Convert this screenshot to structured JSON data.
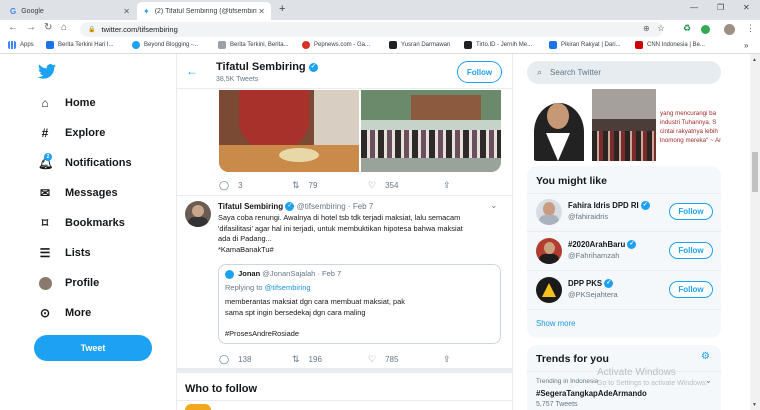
{
  "browser": {
    "tabs": [
      {
        "title": "Google"
      },
      {
        "title": "(2) Tifatul Sembiring (@tifsembiri"
      }
    ],
    "url": "twitter.com/tifsembiring",
    "bookmarks": [
      {
        "label": "Apps",
        "color": "#4285f4"
      },
      {
        "label": "Berita Terkini Hari I...",
        "color": "#1a73e8"
      },
      {
        "label": "Beyond Blogging -...",
        "color": "#1da1f2"
      },
      {
        "label": "Berita Terkini, Berita...",
        "color": "#9aa0a6"
      },
      {
        "label": "Pepnews.com - Ga...",
        "color": "#d93025"
      },
      {
        "label": "Yusran Darmawan",
        "color": "#202124"
      },
      {
        "label": "Tirto.ID - Jernih Me...",
        "color": "#202124"
      },
      {
        "label": "Pikiran Rakyat | Dari...",
        "color": "#1a73e8"
      },
      {
        "label": "CNN Indonesia | Be...",
        "color": "#cc0000"
      }
    ]
  },
  "nav": {
    "items": [
      {
        "label": "Home"
      },
      {
        "label": "Explore"
      },
      {
        "label": "Notifications",
        "badge": "2"
      },
      {
        "label": "Messages"
      },
      {
        "label": "Bookmarks"
      },
      {
        "label": "Lists"
      },
      {
        "label": "Profile"
      },
      {
        "label": "More"
      }
    ],
    "tweet_label": "Tweet"
  },
  "header": {
    "name": "Tifatul Sembiring",
    "tweets_count": "38,5K Tweets",
    "follow_label": "Follow"
  },
  "tweet1": {
    "replies": "3",
    "retweets": "79",
    "likes": "354"
  },
  "tweet2": {
    "name": "Tifatul Sembiring",
    "handle": "@tifsembiring",
    "date": "· Feb 7",
    "text_lines": [
      "Saya coba renungi. Awalnya di hotel tsb tdk terjadi maksiat, lalu semacam",
      "'difasilitasi' agar hal ini terjadi, untuk membuktikan hipotesa bahwa maksiat",
      "ada di Padang..."
    ],
    "hashtag": "*KamaBanakTu#",
    "quote": {
      "name": "Jonan",
      "handle": "@JonanSajalah",
      "date": "· Feb 7",
      "replying_prefix": "Replying to ",
      "replying_to": "@tifsembiring",
      "text_lines": [
        "memberantas maksiat dgn cara membuat maksiat, pak",
        "sama spt ingin bersedekaj dgn cara maling"
      ],
      "hashtag": "#ProsesAndreRosiade"
    },
    "replies": "138",
    "retweets": "196",
    "likes": "785"
  },
  "who_to_follow": {
    "title": "Who to follow"
  },
  "search": {
    "placeholder": "Search Twitter"
  },
  "media_strip": {
    "lines": [
      "yang mencurangi ba",
      "industri Tuhannya. S",
      "cintai rakyatnya lebih",
      "lnomong mereka\" ~ An"
    ]
  },
  "you_might_like": {
    "title": "You might like",
    "accounts": [
      {
        "name": "Fahira Idris DPD RI",
        "handle": "@fahiraidris",
        "follow": "Follow"
      },
      {
        "name": "#2020ArahBaru",
        "handle": "@Fahrihamzah",
        "follow": "Follow"
      },
      {
        "name": "DPP PKS",
        "handle": "@PKSejahtera",
        "follow": "Follow"
      }
    ],
    "show_more": "Show more"
  },
  "trends": {
    "title": "Trends for you",
    "context": "Trending in Indonesia",
    "topic": "#SegeraTangkapAdeArmando",
    "count": "5,757 Tweets"
  },
  "watermark": {
    "title": "Activate Windows",
    "subtitle": "Go to Settings to activate Windows."
  },
  "colors": {
    "accent": "#1da1f2",
    "border": "#e6ecf0",
    "muted": "#657786"
  }
}
